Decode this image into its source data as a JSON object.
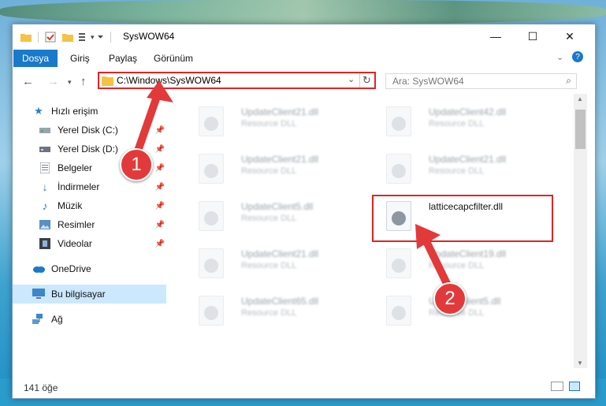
{
  "window": {
    "title": "SysWOW64"
  },
  "window_controls": {
    "minimize": "—",
    "maximize": "☐",
    "close": "✕"
  },
  "ribbon": {
    "tabs": [
      "Dosya",
      "Giriş",
      "Paylaş",
      "Görünüm"
    ]
  },
  "address": {
    "path": "C:\\Windows\\SysWOW64"
  },
  "search": {
    "placeholder": "Ara: SysWOW64"
  },
  "sidebar": {
    "items": [
      {
        "label": "Hızlı erişim"
      },
      {
        "label": "Yerel Disk (C:)"
      },
      {
        "label": "Yerel Disk (D:)"
      },
      {
        "label": "Belgeler"
      },
      {
        "label": "İndirmeler"
      },
      {
        "label": "Müzik"
      },
      {
        "label": "Resimler"
      },
      {
        "label": "Videolar"
      },
      {
        "label": "OneDrive"
      },
      {
        "label": "Bu bilgisayar"
      },
      {
        "label": "Ağ"
      }
    ]
  },
  "files": [
    {
      "name": "UpdateClient21.dll",
      "type": "Resource DLL"
    },
    {
      "name": "UpdateClient42.dll",
      "type": "Resource DLL"
    },
    {
      "name": "UpdateClient21.dll",
      "type": "Resource DLL"
    },
    {
      "name": "UpdateClient21.dll",
      "type": "Resource DLL"
    },
    {
      "name": "UpdateClient5.dll",
      "type": "Resource DLL"
    },
    {
      "name": "latticecapcfilter.dll",
      "type": ""
    },
    {
      "name": "UpdateClient21.dll",
      "type": "Resource DLL"
    },
    {
      "name": "UpdateClient19.dll",
      "type": "Resource DLL"
    },
    {
      "name": "UpdateClient65.dll",
      "type": "Resource DLL"
    },
    {
      "name": "UpdateClient5.dll",
      "type": "Resource DLL"
    }
  ],
  "status": {
    "count": "141 öğe"
  },
  "badges": {
    "one": "1",
    "two": "2"
  },
  "colors": {
    "accent": "#1979ca",
    "highlight": "#e02424",
    "selected": "#cce8ff"
  }
}
